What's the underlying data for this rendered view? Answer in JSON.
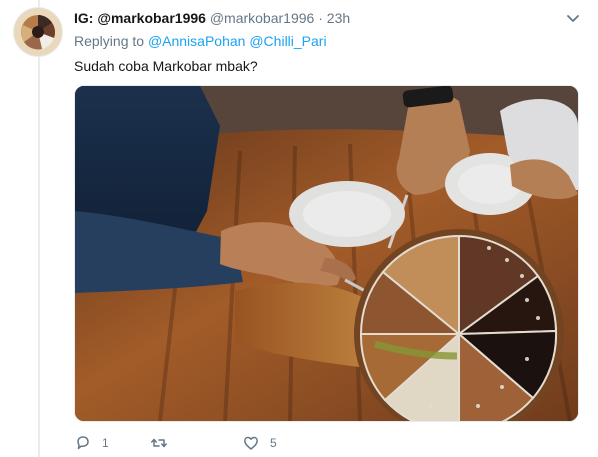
{
  "tweet": {
    "display_name": "IG: @markobar1996",
    "handle": "@markobar1996",
    "separator": "·",
    "time": "23h",
    "reply_prefix": "Replying to",
    "mentions": [
      "@AnnisaPohan",
      "@Chilli_Pari"
    ],
    "text": "Sudah coba Markobar mbak?",
    "media_description_icon": "food-photo",
    "stats": {
      "replies": "1",
      "retweets": "",
      "likes": "5"
    }
  },
  "colors": {
    "link": "#1da1f2",
    "muted": "#657786",
    "text": "#14171a",
    "divider": "#e6ecf0"
  }
}
